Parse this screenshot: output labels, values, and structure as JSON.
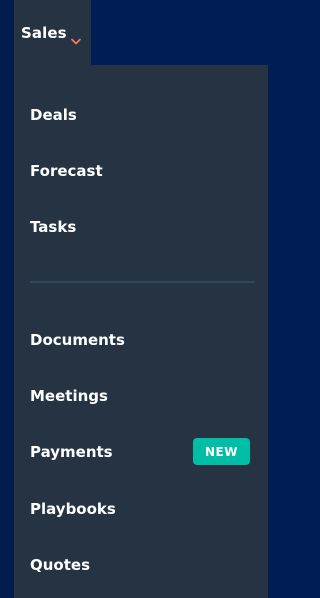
{
  "nav": {
    "tab_label": "Sales",
    "accent_color": "#ff7a59",
    "chevron_icon": "chevron-down-icon"
  },
  "menu": {
    "group1": [
      {
        "label": "Deals"
      },
      {
        "label": "Forecast"
      },
      {
        "label": "Tasks"
      }
    ],
    "group2": [
      {
        "label": "Documents"
      },
      {
        "label": "Meetings"
      },
      {
        "label": "Payments",
        "badge": "NEW"
      },
      {
        "label": "Playbooks"
      },
      {
        "label": "Quotes"
      }
    ]
  },
  "colors": {
    "background": "#001e55",
    "menu_bg": "#253342",
    "divider": "#33475b",
    "badge": "#00bda5"
  }
}
